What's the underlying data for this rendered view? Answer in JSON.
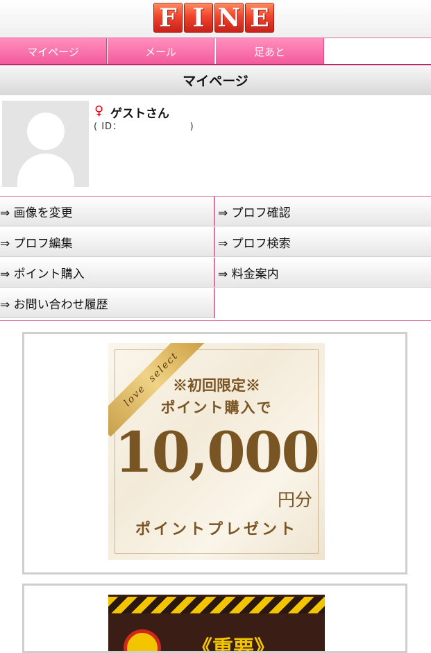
{
  "header": {
    "logo_letters": [
      "F",
      "I",
      "N",
      "E"
    ]
  },
  "nav": {
    "tabs": [
      {
        "label": "マイページ"
      },
      {
        "label": "メール"
      },
      {
        "label": "足あと"
      }
    ]
  },
  "page_title": "マイページ",
  "profile": {
    "gender_symbol": "♀",
    "username": "ゲストさん",
    "id_label": "( ID：                   )"
  },
  "menu": {
    "items": [
      {
        "label": "⇒ 画像を変更"
      },
      {
        "label": "⇒ プロフ確認"
      },
      {
        "label": "⇒ プロフ編集"
      },
      {
        "label": "⇒ プロフ検索"
      },
      {
        "label": "⇒ ポイント購入"
      },
      {
        "label": "⇒ 料金案内"
      },
      {
        "label": "⇒ お問い合わせ履歴"
      }
    ]
  },
  "promo_banner": {
    "ribbon": "love  select",
    "line1": "※初回限定※",
    "line2": "ポイント購入で",
    "amount": "10,000",
    "unit": "円分",
    "line3": "ポイントプレゼント"
  },
  "notice_banner": {
    "title": "《重要》"
  },
  "colors": {
    "accent_pink": "#f25a9c",
    "logo_red": "#f0452c",
    "promo_brown": "#7a5524"
  }
}
